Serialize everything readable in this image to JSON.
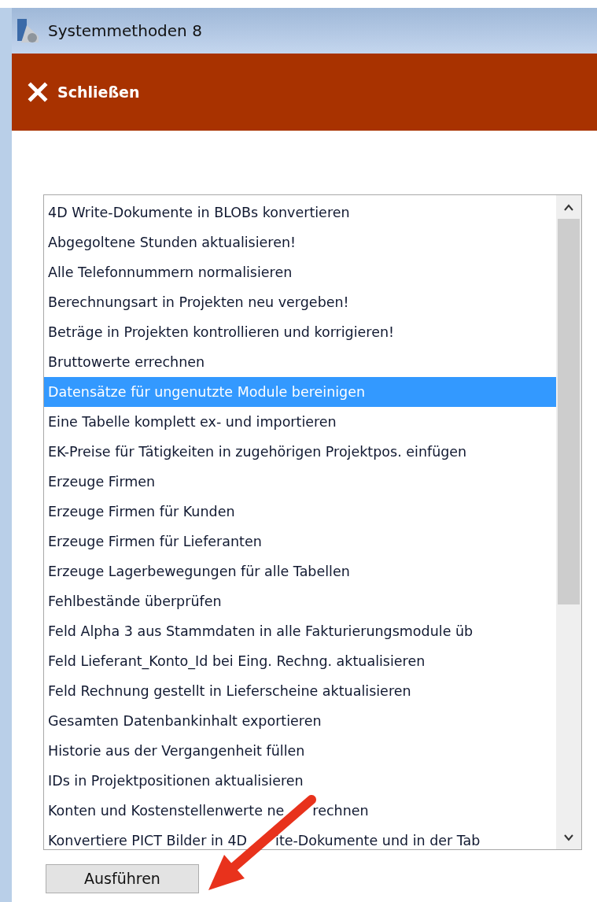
{
  "window": {
    "title": "Systemmethoden 8"
  },
  "toolbar": {
    "close_button": "Schließen"
  },
  "list": {
    "items": [
      {
        "label": "4D Write-Dokumente in BLOBs konvertieren",
        "selected": false
      },
      {
        "label": "Abgegoltene Stunden aktualisieren!",
        "selected": false
      },
      {
        "label": "Alle Telefonnummern normalisieren",
        "selected": false
      },
      {
        "label": "Berechnungsart in Projekten neu vergeben!",
        "selected": false
      },
      {
        "label": "Beträge in Projekten kontrollieren und korrigieren!",
        "selected": false
      },
      {
        "label": "Bruttowerte errechnen",
        "selected": false
      },
      {
        "label": "Datensätze für ungenutzte Module bereinigen",
        "selected": true
      },
      {
        "label": "Eine Tabelle komplett ex- und importieren",
        "selected": false
      },
      {
        "label": "EK-Preise für Tätigkeiten in zugehörigen Projektpos. einfügen",
        "selected": false
      },
      {
        "label": "Erzeuge Firmen",
        "selected": false
      },
      {
        "label": "Erzeuge Firmen für Kunden",
        "selected": false
      },
      {
        "label": "Erzeuge Firmen für Lieferanten",
        "selected": false
      },
      {
        "label": "Erzeuge Lagerbewegungen für alle Tabellen",
        "selected": false
      },
      {
        "label": "Fehlbestände überprüfen",
        "selected": false
      },
      {
        "label": "Feld Alpha 3 aus Stammdaten in alle Fakturierungsmodule üb",
        "selected": false
      },
      {
        "label": "Feld Lieferant_Konto_Id bei Eing. Rechng. aktualisieren",
        "selected": false
      },
      {
        "label": "Feld Rechnung gestellt in Lieferscheine aktualisieren",
        "selected": false
      },
      {
        "label": "Gesamten Datenbankinhalt exportieren",
        "selected": false
      },
      {
        "label": "Historie aus der Vergangenheit füllen",
        "selected": false
      },
      {
        "label": "IDs in Projektpositionen aktualisieren",
        "selected": false
      },
      {
        "parts": [
          "Konten und Kostenstellenwerte ne",
          "rechnen"
        ],
        "selected": false
      },
      {
        "parts": [
          "Konvertiere PICT Bilder in 4D",
          "ite-Dokumente und in der Tab"
        ],
        "selected": false
      }
    ]
  },
  "run_button": "Ausführen"
}
